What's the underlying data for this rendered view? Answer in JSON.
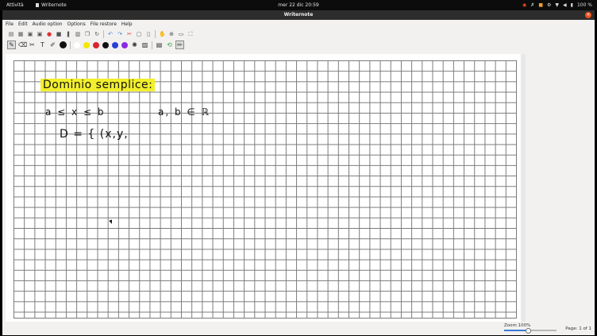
{
  "topbar": {
    "activities": "Attività",
    "app_name": "Writernote",
    "clock": "mer 22 dic  20:59",
    "battery": "100 %"
  },
  "window": {
    "title": "Writernote"
  },
  "menu": [
    "File",
    "Edit",
    "Audio option",
    "Options",
    "File restore",
    "Help"
  ],
  "colors": {
    "yellow": "#f5e800",
    "red": "#d9262e",
    "black": "#111111",
    "blue": "#2a3fd6",
    "purple": "#8a2be2",
    "highlight": "#f2ef2c",
    "accent": "#e95420"
  },
  "handwriting": {
    "title": "Dominio   semplice:",
    "line1": "a ≤ x ≤ b",
    "line1_right": "a, b ∈ ℝ",
    "line2": "D = { (x,y,"
  },
  "status": {
    "zoom": "Zoom 100%",
    "zoom_value": 0.45,
    "page": "Page: 1 of 1"
  }
}
